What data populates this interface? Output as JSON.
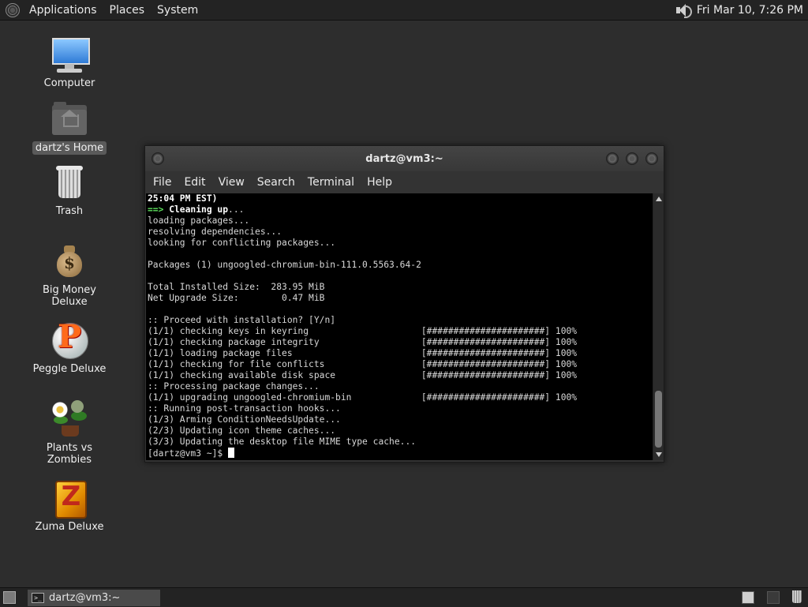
{
  "top_panel": {
    "menus": [
      "Applications",
      "Places",
      "System"
    ],
    "clock": "Fri Mar 10,  7:26 PM",
    "icons": [
      "distro-logo-icon",
      "volume-icon"
    ]
  },
  "desktop": {
    "icons": [
      {
        "label": "Computer",
        "icon": "computer-icon"
      },
      {
        "label": "dartz's Home",
        "icon": "home-folder-icon",
        "selected": true
      },
      {
        "label": "Trash",
        "icon": "trash-icon"
      },
      {
        "label": "Big Money Deluxe",
        "icon": "money-bag-icon"
      },
      {
        "label": "Peggle Deluxe",
        "icon": "peggle-icon"
      },
      {
        "label": "Plants vs Zombies",
        "icon": "plants-vs-zombies-icon"
      },
      {
        "label": "Zuma Deluxe",
        "icon": "zuma-icon"
      }
    ]
  },
  "terminal_window": {
    "title": "dartz@vm3:~",
    "menus": [
      "File",
      "Edit",
      "View",
      "Search",
      "Terminal",
      "Help"
    ],
    "lines": {
      "l0": "25:04 PM EST)",
      "l1_arrow": "==>",
      "l1_text": " Cleaning up",
      "l1_rest": "...",
      "l2": "loading packages...",
      "l3": "resolving dependencies...",
      "l4": "looking for conflicting packages...",
      "l5": "",
      "l6": "Packages (1) ungoogled-chromium-bin-111.0.5563.64-2",
      "l7": "",
      "l8": "Total Installed Size:  283.95 MiB",
      "l9": "Net Upgrade Size:        0.47 MiB",
      "l10": "",
      "l11": ":: Proceed with installation? [Y/n]",
      "l12": "(1/1) checking keys in keyring                     [######################] 100%",
      "l13": "(1/1) checking package integrity                   [######################] 100%",
      "l14": "(1/1) loading package files                        [######################] 100%",
      "l15": "(1/1) checking for file conflicts                  [######################] 100%",
      "l16": "(1/1) checking available disk space                [######################] 100%",
      "l17": ":: Processing package changes...",
      "l18": "(1/1) upgrading ungoogled-chromium-bin             [######################] 100%",
      "l19": ":: Running post-transaction hooks...",
      "l20": "(1/3) Arming ConditionNeedsUpdate...",
      "l21": "(2/3) Updating icon theme caches...",
      "l22": "(3/3) Updating the desktop file MIME type cache...",
      "l23": "[dartz@vm3 ~]$ "
    }
  },
  "bottom_panel": {
    "task_label": "dartz@vm3:~",
    "task_icon": ">_"
  }
}
